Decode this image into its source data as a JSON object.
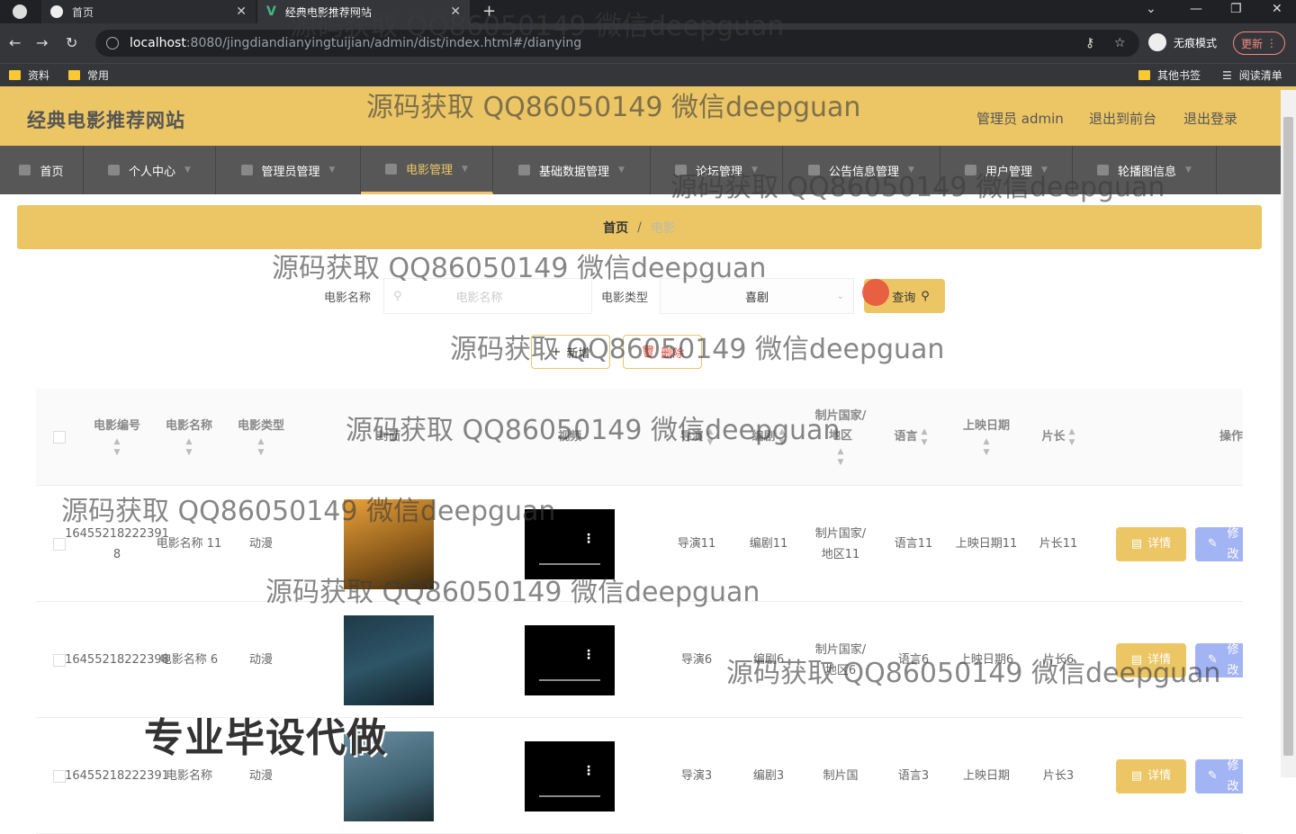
{
  "browser": {
    "tabs": [
      {
        "label": "首页",
        "active": false
      },
      {
        "label": "经典电影推荐网站",
        "active": true
      }
    ],
    "url_host": "localhost",
    "url_rest": ":8080/jingdiandianyingtuijian/admin/dist/index.html#/dianying",
    "incognito_label": "无痕模式",
    "update_label": "更新",
    "bookmarks": [
      "资料",
      "常用"
    ],
    "bookmarks_right": [
      "其他书签",
      "阅读清单"
    ]
  },
  "header": {
    "site_title": "经典电影推荐网站",
    "admin_label": "管理员 admin",
    "front_label": "退出到前台",
    "logout_label": "退出登录"
  },
  "nav": [
    {
      "label": "首页",
      "has_chevron": false
    },
    {
      "label": "个人中心",
      "has_chevron": true
    },
    {
      "label": "管理员管理",
      "has_chevron": true
    },
    {
      "label": "电影管理",
      "has_chevron": true,
      "active": true
    },
    {
      "label": "基础数据管理",
      "has_chevron": true
    },
    {
      "label": "论坛管理",
      "has_chevron": true
    },
    {
      "label": "公告信息管理",
      "has_chevron": true
    },
    {
      "label": "用户管理",
      "has_chevron": true
    },
    {
      "label": "轮播图信息",
      "has_chevron": true
    }
  ],
  "breadcrumb": {
    "home": "首页",
    "sep": "/",
    "current": "电影"
  },
  "search": {
    "name_label": "电影名称",
    "name_placeholder": "电影名称",
    "type_label": "电影类型",
    "type_value": "喜剧",
    "query_label": "查询"
  },
  "actions": {
    "add_label": "新增",
    "delete_label": "删除"
  },
  "table": {
    "headers": [
      "电影编号",
      "电影名称",
      "电影类型",
      "封面",
      "视频",
      "导演",
      "编剧",
      "制片国家/地区",
      "语言",
      "上映日期",
      "片长",
      "操作"
    ],
    "detail_label": "详情",
    "edit_label": "修改",
    "rows": [
      {
        "id": "16455218222391 8",
        "name": "电影名称 11",
        "type": "动漫",
        "director": "导演11",
        "writer": "编剧11",
        "country": "制片国家/地区11",
        "language": "语言11",
        "date": "上映日期11",
        "length": "片长11"
      },
      {
        "id": "16455218222398",
        "name": "电影名称 6",
        "type": "动漫",
        "director": "导演6",
        "writer": "编剧6",
        "country": "制片国家/地区6",
        "language": "语言6",
        "date": "上映日期6",
        "length": "片长6"
      },
      {
        "id": "16455218222391",
        "name": "电影名称",
        "type": "动漫",
        "director": "导演3",
        "writer": "编剧3",
        "country": "制片国",
        "language": "语言3",
        "date": "上映日期",
        "length": "片长3"
      }
    ]
  },
  "watermark": {
    "text": "源码获取 QQ86050149 微信deepguan",
    "big_text": "专业毕设代做"
  }
}
